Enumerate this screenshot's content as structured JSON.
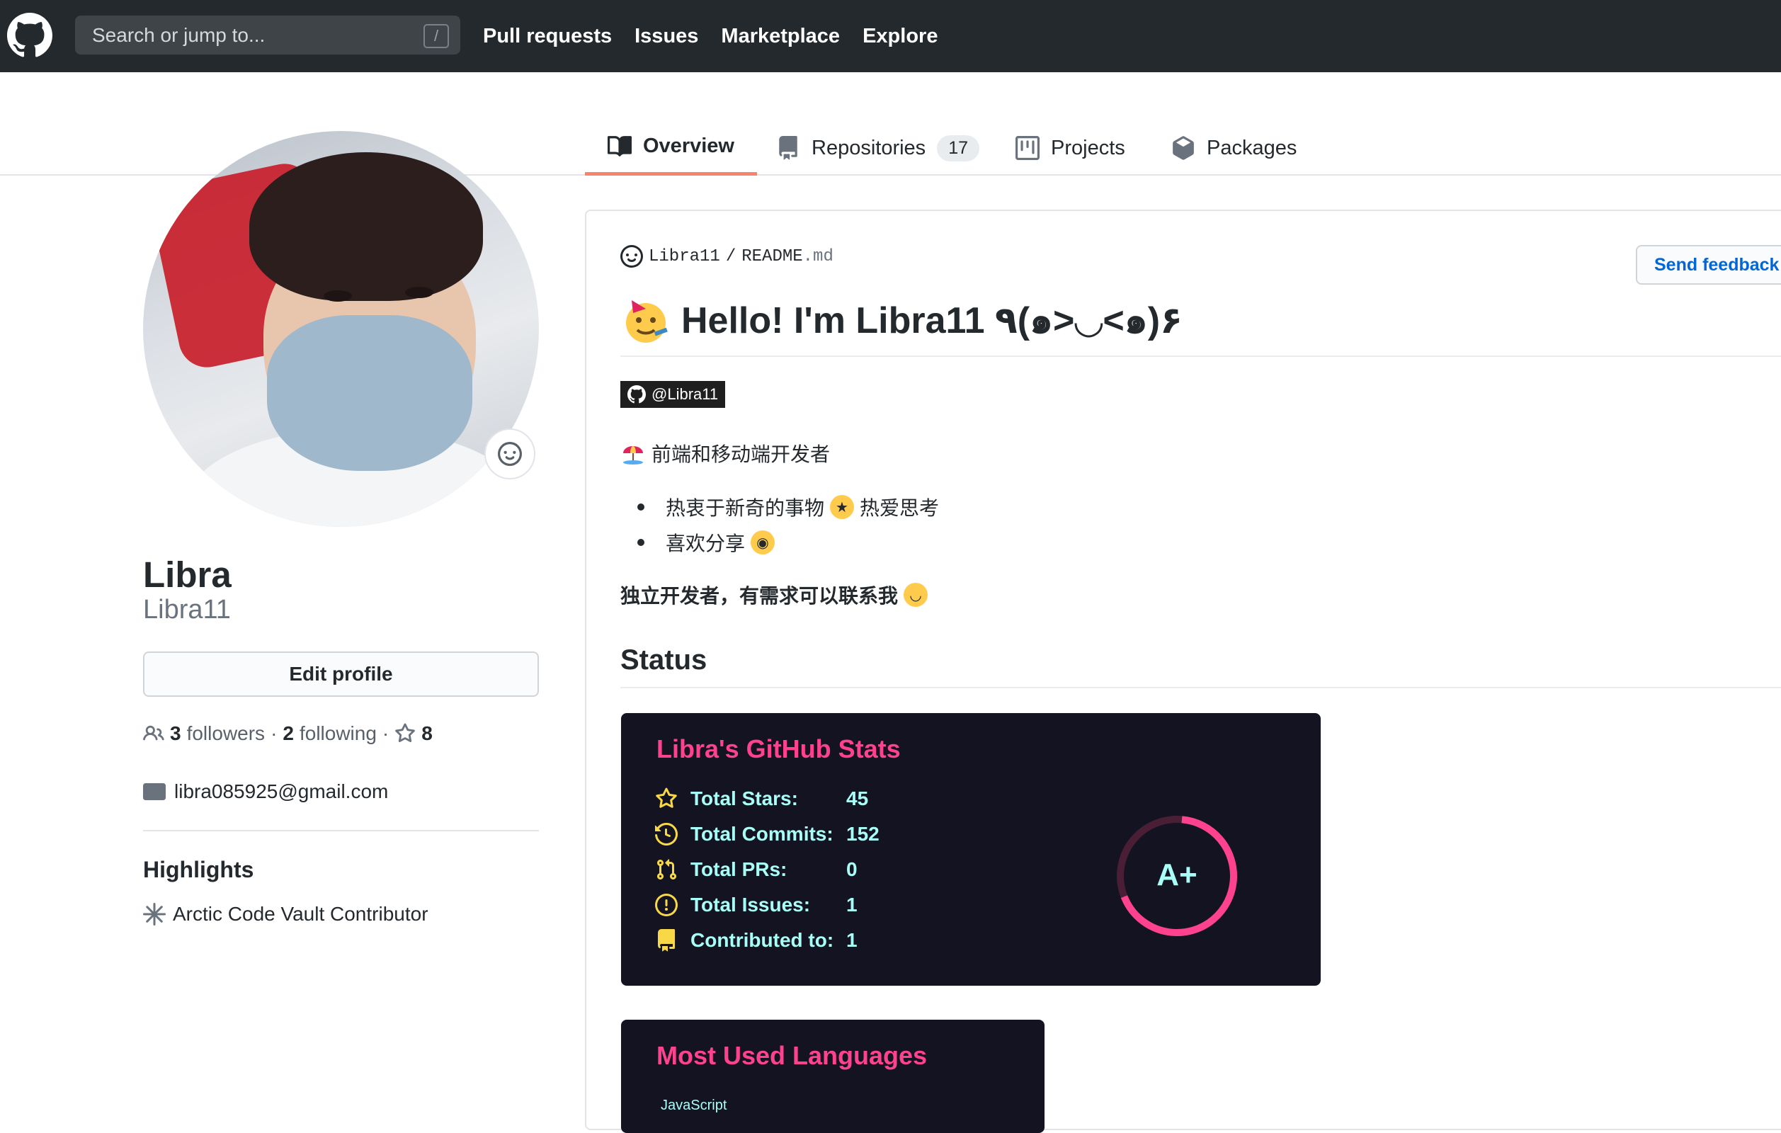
{
  "header": {
    "search_placeholder": "Search or jump to...",
    "search_shortcut": "/",
    "nav": [
      "Pull requests",
      "Issues",
      "Marketplace",
      "Explore"
    ]
  },
  "tabs": {
    "overview": "Overview",
    "repositories": "Repositories",
    "repositories_count": "17",
    "projects": "Projects",
    "packages": "Packages"
  },
  "profile": {
    "name": "Libra",
    "login": "Libra11",
    "edit_label": "Edit profile",
    "followers_count": "3",
    "followers_label": "followers",
    "following_count": "2",
    "following_label": "following",
    "stars_count": "8",
    "email": "libra085925@gmail.com",
    "highlights_title": "Highlights",
    "highlight_item": "Arctic Code Vault Contributor"
  },
  "readme": {
    "owner": "Libra11",
    "separator": "/",
    "file_name": "README",
    "file_ext": ".md",
    "feedback_label": "Send feedback",
    "heading": "Hello! I'm Libra11 ٩(๑>◡<๑)۶",
    "badge": "@Libra11",
    "intro": "前端和移动端开发者",
    "bullet_1a": "热衷于新奇的事物",
    "bullet_1b": "热爱思考",
    "bullet_2": "喜欢分享",
    "contact": "独立开发者，有需求可以联系我",
    "status_heading": "Status"
  },
  "stats_card": {
    "title": "Libra's GitHub Stats",
    "rows": [
      {
        "label": "Total Stars:",
        "value": "45"
      },
      {
        "label": "Total Commits:",
        "value": "152"
      },
      {
        "label": "Total PRs:",
        "value": "0"
      },
      {
        "label": "Total Issues:",
        "value": "1"
      },
      {
        "label": "Contributed to:",
        "value": "1"
      }
    ],
    "grade": "A+",
    "accent": "#fe428e",
    "text_color": "#a9fef7",
    "icon_color": "#f8d847",
    "background": "#141321"
  },
  "languages_card": {
    "title": "Most Used Languages",
    "first_language": "JavaScript"
  }
}
